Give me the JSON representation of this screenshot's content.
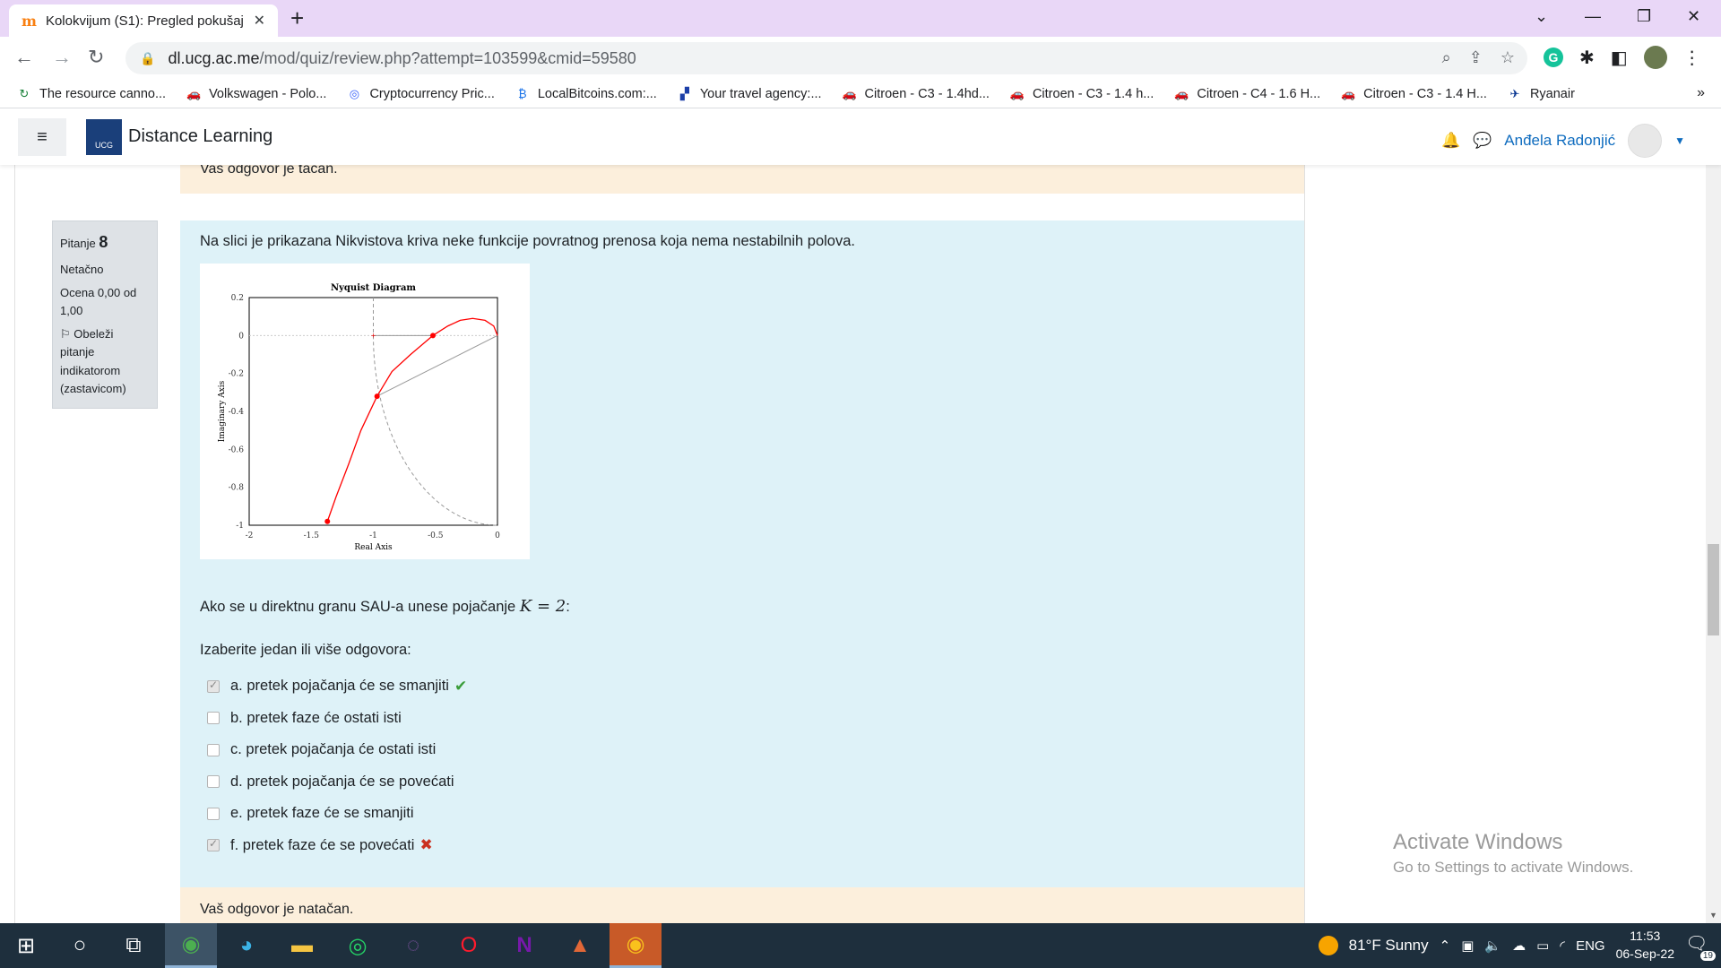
{
  "browser": {
    "tab_title": "Kolokvijum (S1): Pregled pokušaj",
    "url_host": "dl.ucg.ac.me",
    "url_path": "/mod/quiz/review.php?attempt=103599&cmid=59580",
    "bookmarks": [
      {
        "label": "The resource canno...",
        "icon": "refresh-icon",
        "color": "#188038"
      },
      {
        "label": "Volkswagen - Polo...",
        "icon": "car-icon",
        "color": "#202124"
      },
      {
        "label": "Cryptocurrency Pric...",
        "icon": "coin-icon",
        "color": "#3861fb"
      },
      {
        "label": "LocalBitcoins.com:...",
        "icon": "bitcoin-icon",
        "color": "#1a73e8"
      },
      {
        "label": "Your travel agency:...",
        "icon": "travel-icon",
        "color": "#1c3fa8"
      },
      {
        "label": "Citroen - C3 - 1.4hd...",
        "icon": "car-icon",
        "color": "#202124"
      },
      {
        "label": "Citroen - C3 - 1.4 h...",
        "icon": "car-icon",
        "color": "#202124"
      },
      {
        "label": "Citroen - C4 - 1.6 H...",
        "icon": "car-icon",
        "color": "#202124"
      },
      {
        "label": "Citroen - C3 - 1.4 H...",
        "icon": "car-icon",
        "color": "#202124"
      },
      {
        "label": "Ryanair",
        "icon": "ryanair-icon",
        "color": "#073590"
      }
    ]
  },
  "moodle": {
    "site_name": "Distance Learning",
    "logo_text": "UCG",
    "user_name": "Anđela Radonjić"
  },
  "question": {
    "label": "Pitanje",
    "number": "8",
    "status": "Netačno",
    "grade": "Ocena 0,00 od 1,00",
    "flag": "Obeleži pitanje indikatorom (zastavicom)",
    "text": "Na slici je prikazana Nikvistova kriva neke funkcije povratnog prenosa koja nema nestabilnih polova.",
    "sub_text_before": "Ako se u direktnu granu SAU-a unese pojačanje",
    "sub_math": "K = 2",
    "sub_text_after": ":",
    "prompt": "Izaberite jedan ili više odgovora:",
    "answers": [
      {
        "text": "a. pretek pojačanja će se smanjiti",
        "checked": true,
        "mark": "✔"
      },
      {
        "text": "b. pretek faze će ostati isti",
        "checked": false,
        "mark": ""
      },
      {
        "text": "c. pretek pojačanja će ostati isti",
        "checked": false,
        "mark": ""
      },
      {
        "text": "d. pretek pojačanja će se povećati",
        "checked": false,
        "mark": ""
      },
      {
        "text": "e. pretek faze će se smanjiti",
        "checked": false,
        "mark": ""
      },
      {
        "text": "f. pretek faze će se povećati",
        "checked": true,
        "mark": "✖"
      }
    ],
    "feedback_top": "Vaš odgovor je tačan.",
    "feedback_bottom": "Vaš odgovor je natačan."
  },
  "chart_data": {
    "type": "line",
    "title": "Nyquist Diagram",
    "xlabel": "Real Axis",
    "ylabel": "Imaginary Axis",
    "xlim": [
      -2,
      0
    ],
    "ylim": [
      -1,
      0.2
    ],
    "xticks": [
      "-2",
      "-1.5",
      "-1",
      "-0.5",
      "0"
    ],
    "yticks": [
      "0.2",
      "0",
      "-0.2",
      "-0.4",
      "-0.6",
      "-0.8",
      "-1"
    ],
    "series": [
      {
        "color": "#ff0000",
        "x": [
          -1.37,
          -1.3,
          -1.2,
          -1.1,
          -0.97,
          -0.85,
          -0.7,
          -0.52,
          -0.4,
          -0.3,
          -0.2,
          -0.1,
          -0.03,
          0
        ],
        "y": [
          -0.98,
          -0.85,
          -0.68,
          -0.5,
          -0.32,
          -0.19,
          -0.1,
          0.0,
          0.05,
          0.08,
          0.09,
          0.08,
          0.05,
          0.0
        ],
        "markers": [
          [
            -1.37,
            -0.98
          ],
          [
            -0.52,
            0.0
          ],
          [
            -0.97,
            -0.32
          ]
        ]
      }
    ],
    "unit_circle": true,
    "guide_lines": [
      [
        [
          -1,
          0
        ],
        [
          -0.52,
          0.0
        ]
      ],
      [
        [
          -0.97,
          -0.32
        ],
        [
          0,
          0
        ]
      ]
    ]
  },
  "watermark": {
    "line1": "Activate Windows",
    "line2": "Go to Settings to activate Windows."
  },
  "taskbar": {
    "weather": "81°F  Sunny",
    "lang": "ENG",
    "time": "11:53",
    "date": "06-Sep-22",
    "notifications": "19"
  }
}
